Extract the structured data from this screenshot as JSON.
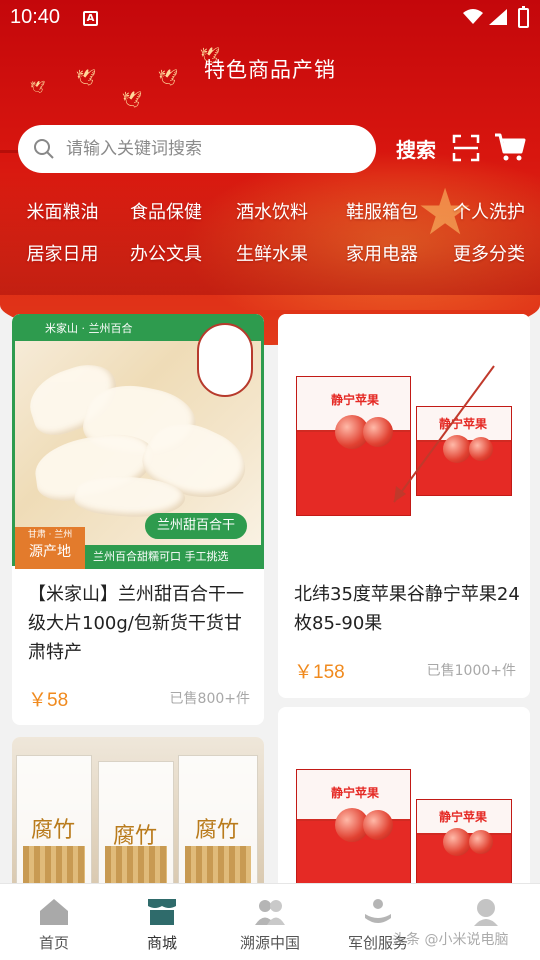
{
  "status_bar": {
    "time": "10:40"
  },
  "header": {
    "title": "特色商品产销",
    "search_placeholder": "请输入关键词搜索",
    "search_label": "搜索"
  },
  "categories": {
    "row1": [
      "米面粮油",
      "食品保健",
      "酒水饮料",
      "鞋服箱包",
      "个人洗护"
    ],
    "row2": [
      "居家日用",
      "办公文具",
      "生鲜水果",
      "家用电器",
      "更多分类"
    ]
  },
  "products": [
    {
      "name": "【米家山】兰州甜百合干一级大片100g/包新货干货甘肃特产",
      "price": "￥58",
      "sold": "已售800+件",
      "image": {
        "brand_bar": "米家山 · 兰州百合",
        "product_tag": "兰州甜百合干",
        "origin_small": "甘肃 · 兰州",
        "origin_big": "源产地",
        "footer_text": "兰州百合甜糯可口  手工挑选"
      }
    },
    {
      "name": "北纬35度苹果谷静宁苹果24枚85-90果",
      "price": "￥158",
      "sold": "已售1000+件",
      "image": {
        "box_label": "静宁苹果"
      }
    },
    {
      "name": "",
      "image": {
        "bag_label": "腐竹"
      }
    },
    {
      "name": "",
      "image": {
        "box_label": "静宁苹果"
      }
    }
  ],
  "tabbar": [
    {
      "label": "首页",
      "icon": "home-icon"
    },
    {
      "label": "商城",
      "icon": "store-icon",
      "active": true
    },
    {
      "label": "溯源中国",
      "icon": "people-icon"
    },
    {
      "label": "军创服务",
      "icon": "service-hand-icon"
    },
    {
      "label": "",
      "icon": "profile-icon"
    }
  ],
  "watermark": "头条 @小米说电脑",
  "colors": {
    "header_red": "#c4070b",
    "price_orange": "#f08a1e",
    "lily_green": "#2e9b4e",
    "tab_active": "#2f6b6b"
  }
}
